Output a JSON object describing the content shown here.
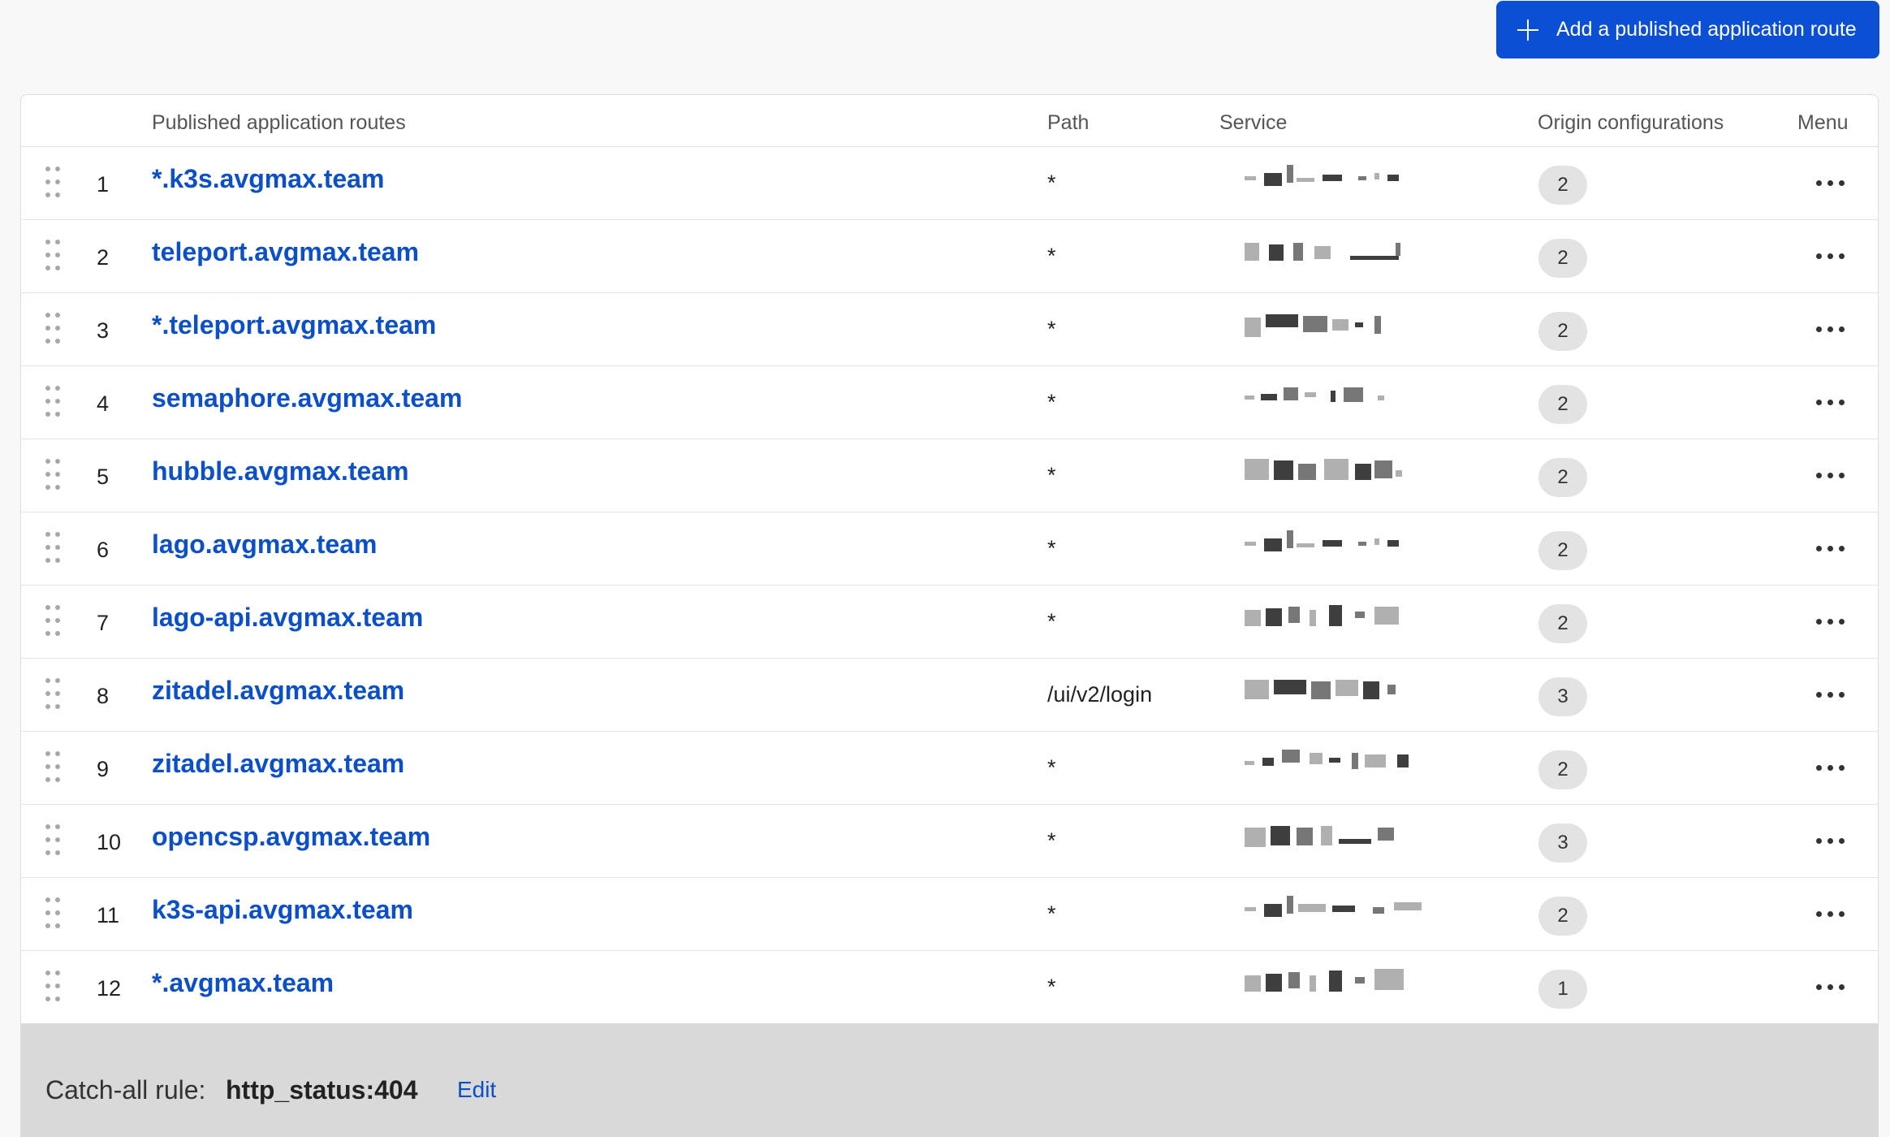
{
  "toolbar": {
    "add_route_label": "Add a published application route",
    "add_icon": "plus-icon"
  },
  "table": {
    "headers": {
      "routes": "Published application routes",
      "path": "Path",
      "service": "Service",
      "origin": "Origin configurations",
      "menu": "Menu"
    },
    "rows": [
      {
        "index": "1",
        "hostname": "*.k3s.avgmax.team",
        "path": "*",
        "origin_count": "2"
      },
      {
        "index": "2",
        "hostname": "teleport.avgmax.team",
        "path": "*",
        "origin_count": "2"
      },
      {
        "index": "3",
        "hostname": "*.teleport.avgmax.team",
        "path": "*",
        "origin_count": "2"
      },
      {
        "index": "4",
        "hostname": "semaphore.avgmax.team",
        "path": "*",
        "origin_count": "2"
      },
      {
        "index": "5",
        "hostname": "hubble.avgmax.team",
        "path": "*",
        "origin_count": "2"
      },
      {
        "index": "6",
        "hostname": "lago.avgmax.team",
        "path": "*",
        "origin_count": "2"
      },
      {
        "index": "7",
        "hostname": "lago-api.avgmax.team",
        "path": "*",
        "origin_count": "2"
      },
      {
        "index": "8",
        "hostname": "zitadel.avgmax.team",
        "path": "/ui/v2/login",
        "origin_count": "3"
      },
      {
        "index": "9",
        "hostname": "zitadel.avgmax.team",
        "path": "*",
        "origin_count": "2"
      },
      {
        "index": "10",
        "hostname": "opencsp.avgmax.team",
        "path": "*",
        "origin_count": "3"
      },
      {
        "index": "11",
        "hostname": "k3s-api.avgmax.team",
        "path": "*",
        "origin_count": "2"
      },
      {
        "index": "12",
        "hostname": "*.avgmax.team",
        "path": "*",
        "origin_count": "1"
      }
    ]
  },
  "catch_all": {
    "label": "Catch-all rule:",
    "value": "http_status:404",
    "edit_label": "Edit"
  }
}
